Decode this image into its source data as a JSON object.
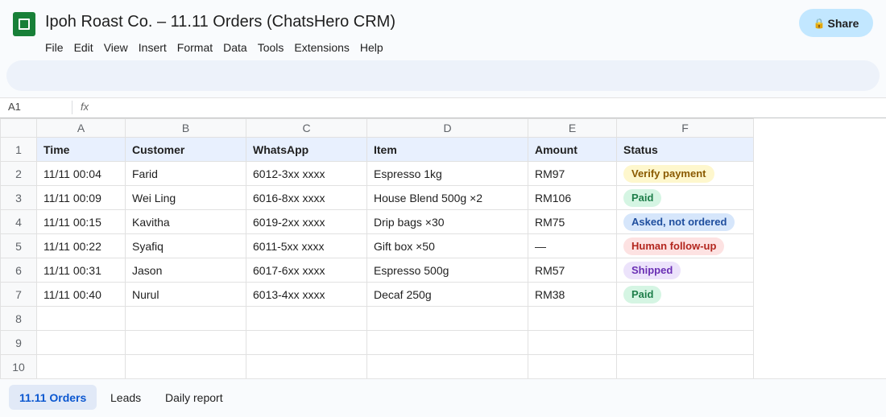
{
  "app": {
    "title": "Ipoh Roast Co. – 11.11 Orders (ChatsHero CRM)",
    "logo_icon": "google-sheets-icon"
  },
  "menu": [
    "File",
    "Edit",
    "View",
    "Insert",
    "Format",
    "Data",
    "Tools",
    "Extensions",
    "Help"
  ],
  "share": {
    "label": "Share",
    "icon": "lock-icon"
  },
  "formula_bar": {
    "cell_ref": "A1",
    "fx_label": "fx"
  },
  "grid": {
    "columns": [
      "A",
      "B",
      "C",
      "D",
      "E",
      "F"
    ],
    "row_numbers": [
      "1",
      "2",
      "3",
      "4",
      "5",
      "6",
      "7",
      "8",
      "9",
      "10"
    ],
    "headers": [
      "Time",
      "Customer",
      "WhatsApp",
      "Item",
      "Amount",
      "Status"
    ],
    "rows": [
      {
        "time": "11/11 00:04",
        "customer": "Farid",
        "whatsapp": "6012-3xx xxxx",
        "item": "Espresso 1kg",
        "amount": "RM97",
        "status": "Verify payment",
        "status_color": "#fef7cd"
      },
      {
        "time": "11/11 00:09",
        "customer": "Wei Ling",
        "whatsapp": "6016-8xx xxxx",
        "item": "House Blend 500g ×2",
        "amount": "RM106",
        "status": "Paid",
        "status_color": "#d5f5e3"
      },
      {
        "time": "11/11 00:15",
        "customer": "Kavitha",
        "whatsapp": "6019-2xx xxxx",
        "item": "Drip bags ×30",
        "amount": "RM75",
        "status": "Asked, not ordered",
        "status_color": "#d6e6fb"
      },
      {
        "time": "11/11 00:22",
        "customer": "Syafiq",
        "whatsapp": "6011-5xx xxxx",
        "item": "Gift box ×50",
        "amount": "—",
        "status": "Human follow-up",
        "status_color": "#fde2e2"
      },
      {
        "time": "11/11 00:31",
        "customer": "Jason",
        "whatsapp": "6017-6xx xxxx",
        "item": "Espresso 500g",
        "amount": "RM57",
        "status": "Shipped",
        "status_color": "#ece3fb"
      },
      {
        "time": "11/11 00:40",
        "customer": "Nurul",
        "whatsapp": "6013-4xx xxxx",
        "item": "Decaf 250g",
        "amount": "RM38",
        "status": "Paid",
        "status_color": "#d5f5e3"
      }
    ]
  },
  "sheet_tabs": [
    {
      "label": "11.11 Orders",
      "active": true
    },
    {
      "label": "Leads",
      "active": false
    },
    {
      "label": "Daily report",
      "active": false
    }
  ]
}
